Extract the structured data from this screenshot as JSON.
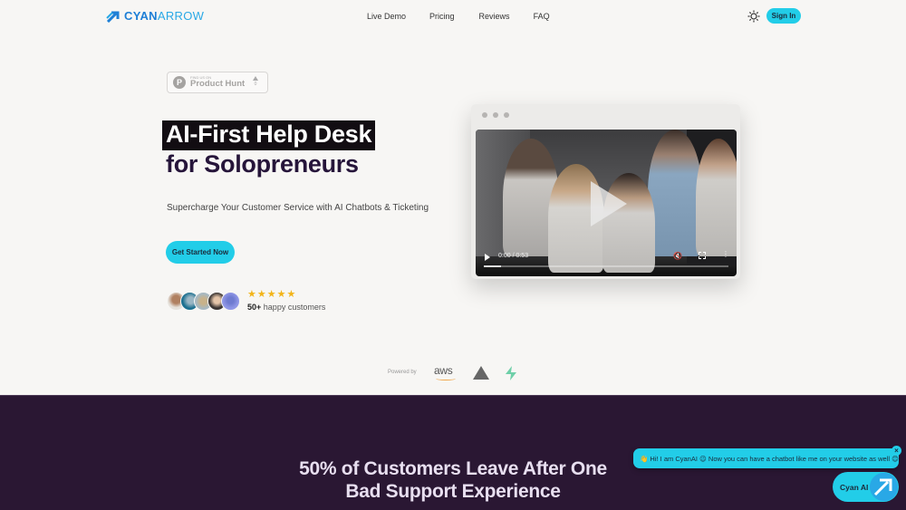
{
  "nav": {
    "logo_part1": "CYAN",
    "logo_part2": "ARROW",
    "links": [
      "Live Demo",
      "Pricing",
      "Reviews",
      "FAQ"
    ],
    "sign_in_label": "Sign In"
  },
  "hero": {
    "product_hunt": {
      "small_label": "FIND US ON",
      "name": "Product Hunt",
      "votes": "0"
    },
    "title_line1": "AI-First Help Desk",
    "title_line2": "for Solopreneurs",
    "subtitle": "Supercharge Your Customer Service with AI Chatbots & Ticketing",
    "cta_label": "Get Started Now",
    "rating_stars": 5,
    "customers_count": "50+",
    "customers_label": "happy customers"
  },
  "video": {
    "time": "0:00 / 0:53",
    "progress_fraction": 0.07
  },
  "powered_by": {
    "label": "Powered by",
    "aws_label": "aws"
  },
  "section2": {
    "headline_line1": "50% of Customers Leave After One",
    "headline_line2": "Bad Support Experience"
  },
  "chat": {
    "message": "👋 Hi! I am CyanAI 😉 Now you can have a chatbot like me on your website as well 😊",
    "close_label": "×",
    "launcher_label": "Cyan AI"
  },
  "colors": {
    "accent": "#22cde8",
    "dark_bg": "#2a1733",
    "page_bg": "#f7f6f4",
    "star": "#f2b419"
  }
}
